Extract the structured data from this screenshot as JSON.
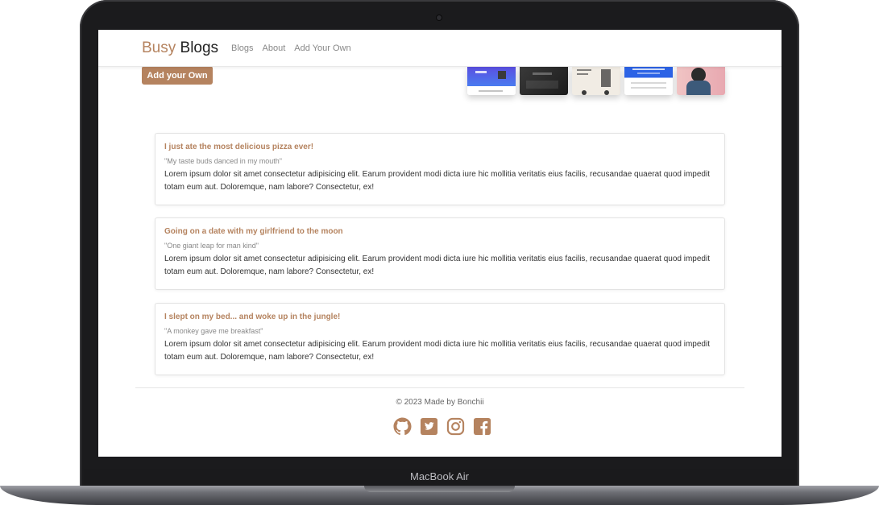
{
  "device": {
    "label": "MacBook Air"
  },
  "navbar": {
    "brand_accent": "Busy",
    "brand_main": "Blogs",
    "links": [
      "Blogs",
      "About",
      "Add Your Own"
    ]
  },
  "hero": {
    "add_button": "Add your Own"
  },
  "posts": [
    {
      "title": "I just ate the most delicious pizza ever!",
      "subtitle": "\"My taste buds danced in my mouth\"",
      "body": "Lorem ipsum dolor sit amet consectetur adipisicing elit. Earum provident modi dicta iure hic mollitia veritatis eius facilis, recusandae quaerat quod impedit totam eum aut. Doloremque, nam labore? Consectetur, ex!"
    },
    {
      "title": "Going on a date with my girlfriend to the moon",
      "subtitle": "\"One giant leap for man kind\"",
      "body": "Lorem ipsum dolor sit amet consectetur adipisicing elit. Earum provident modi dicta iure hic mollitia veritatis eius facilis, recusandae quaerat quod impedit totam eum aut. Doloremque, nam labore? Consectetur, ex!"
    },
    {
      "title": "I slept on my bed... and woke up in the jungle!",
      "subtitle": "\"A monkey gave me breakfast\"",
      "body": "Lorem ipsum dolor sit amet consectetur adipisicing elit. Earum provident modi dicta iure hic mollitia veritatis eius facilis, recusandae quaerat quod impedit totam eum aut. Doloremque, nam labore? Consectetur, ex!"
    }
  ],
  "footer": {
    "text": "© 2023 Made by Bonchii",
    "icons": [
      "github-icon",
      "twitter-icon",
      "instagram-icon",
      "facebook-icon"
    ]
  },
  "colors": {
    "accent": "#b5835f",
    "text": "#333333",
    "muted": "#888888"
  }
}
